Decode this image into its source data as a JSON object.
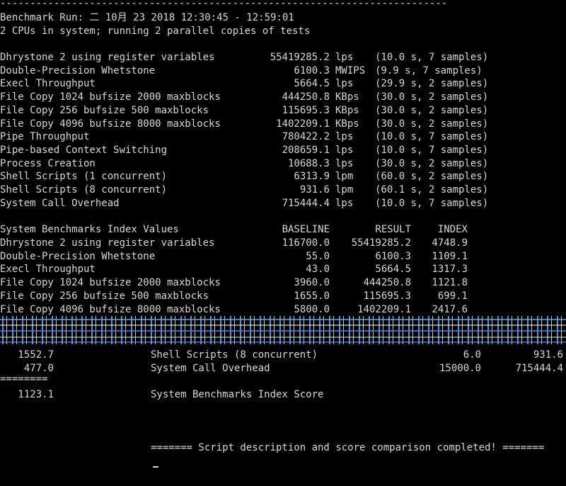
{
  "header": {
    "rule": "--------------------------------------------------------------------------------------------",
    "run_line": "Benchmark Run: 二 10月 23 2018 12:30:45 - 12:59:01",
    "cpu_line": "2 CPUs in system; running 2 parallel copies of tests"
  },
  "results": [
    {
      "name": "Dhrystone 2 using register variables",
      "value": "55419285.2",
      "unit": "lps",
      "detail": "(10.0 s, 7 samples)"
    },
    {
      "name": "Double-Precision Whetstone",
      "value": "6100.3",
      "unit": "MWIPS",
      "detail": "(9.9 s, 7 samples)"
    },
    {
      "name": "Execl Throughput",
      "value": "5664.5",
      "unit": "lps",
      "detail": "(29.9 s, 2 samples)"
    },
    {
      "name": "File Copy 1024 bufsize 2000 maxblocks",
      "value": "444250.8",
      "unit": "KBps",
      "detail": "(30.0 s, 2 samples)"
    },
    {
      "name": "File Copy 256 bufsize 500 maxblocks",
      "value": "115695.3",
      "unit": "KBps",
      "detail": "(30.0 s, 2 samples)"
    },
    {
      "name": "File Copy 4096 bufsize 8000 maxblocks",
      "value": "1402209.1",
      "unit": "KBps",
      "detail": "(30.0 s, 2 samples)"
    },
    {
      "name": "Pipe Throughput",
      "value": "780422.2",
      "unit": "lps",
      "detail": "(10.0 s, 7 samples)"
    },
    {
      "name": "Pipe-based Context Switching",
      "value": "208659.1",
      "unit": "lps",
      "detail": "(10.0 s, 7 samples)"
    },
    {
      "name": "Process Creation",
      "value": "10688.3",
      "unit": "lps",
      "detail": "(30.0 s, 2 samples)"
    },
    {
      "name": "Shell Scripts (1 concurrent)",
      "value": "6313.9",
      "unit": "lpm",
      "detail": "(60.0 s, 2 samples)"
    },
    {
      "name": "Shell Scripts (8 concurrent)",
      "value": "931.6",
      "unit": "lpm",
      "detail": "(60.1 s, 2 samples)"
    },
    {
      "name": "System Call Overhead",
      "value": "715444.4",
      "unit": "lps",
      "detail": "(10.0 s, 7 samples)"
    }
  ],
  "index_table": {
    "title": "System Benchmarks Index Values",
    "col_baseline": "BASELINE",
    "col_result": "RESULT",
    "col_index": "INDEX",
    "rows": [
      {
        "name": "Dhrystone 2 using register variables",
        "baseline": "116700.0",
        "result": "55419285.2",
        "index": "4748.9"
      },
      {
        "name": "Double-Precision Whetstone",
        "baseline": "55.0",
        "result": "6100.3",
        "index": "1109.1"
      },
      {
        "name": "Execl Throughput",
        "baseline": "43.0",
        "result": "5664.5",
        "index": "1317.3"
      },
      {
        "name": "File Copy 1024 bufsize 2000 maxblocks",
        "baseline": "3960.0",
        "result": "444250.8",
        "index": "1121.8"
      },
      {
        "name": "File Copy 256 bufsize 500 maxblocks",
        "baseline": "1655.0",
        "result": "115695.3",
        "index": "699.1"
      },
      {
        "name": "File Copy 4096 bufsize 8000 maxblocks",
        "baseline": "5800.0",
        "result": "1402209.1",
        "index": "2417.6"
      }
    ]
  },
  "shifted": {
    "row1_index": "1552.7",
    "row1_name": "Shell Scripts (8 concurrent)",
    "row1_baseline": "6.0",
    "row1_result": "931.6",
    "row2_index": "477.0",
    "row2_name": "System Call Overhead",
    "row2_baseline": "15000.0",
    "row2_result": "715444.4",
    "equals": "========",
    "score_value": "1123.1",
    "score_label": "System Benchmarks Index Score",
    "completion": "======= Script description and score comparison completed! ======="
  }
}
